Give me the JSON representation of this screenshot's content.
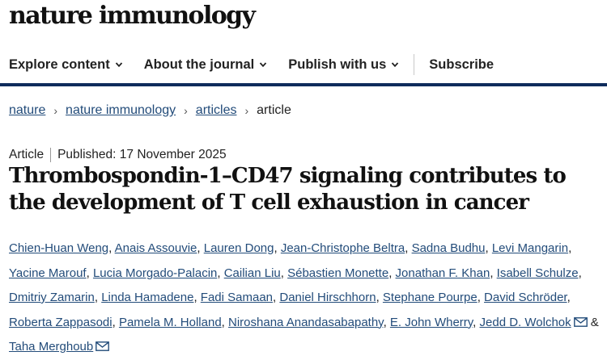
{
  "logo": "nature immunology",
  "nav": {
    "items": [
      {
        "label": "Explore content",
        "icon": "chevron-down-icon"
      },
      {
        "label": "About the journal",
        "icon": "chevron-down-icon"
      },
      {
        "label": "Publish with us",
        "icon": "chevron-down-icon"
      }
    ],
    "subscribe": "Subscribe"
  },
  "breadcrumb": {
    "items": [
      "nature",
      "nature immunology",
      "articles"
    ],
    "current": "article",
    "separator": "›"
  },
  "article": {
    "type": "Article",
    "published": "Published: 17 November 2025",
    "title": "Thrombospondin-1–CD47 signaling contributes to the development of T cell exhaustion in cancer",
    "authors": [
      "Chien-Huan Weng",
      "Anais Assouvie",
      "Lauren Dong",
      "Jean-Christophe Beltra",
      "Sadna Budhu",
      "Levi Mangarin",
      "Yacine Marouf",
      "Lucia Morgado-Palacin",
      "Cailian Liu",
      "Sébastien Monette",
      "Jonathan F. Khan",
      "Isabell Schulze",
      "Dmitriy Zamarin",
      "Linda Hamadene",
      "Fadi Samaan",
      "Daniel Hirschhorn",
      "Stephane Pourpe",
      "David Schröder",
      "Roberta Zappasodi",
      "Pamela M. Holland",
      "Niroshana Anandasabapathy",
      "E. John Wherry",
      "Jedd D. Wolchok",
      "Taha Merghoub"
    ],
    "corresponding_authors": [
      "Jedd D. Wolchok",
      "Taha Merghoub"
    ],
    "author_separator": ",",
    "last_joiner": "&"
  },
  "colors": {
    "link": "#234c7a",
    "nav_underline": "#0f2c5c",
    "text": "#222222"
  },
  "icons": {
    "mail": "mail-icon",
    "chevron": "chevron-down-icon"
  }
}
